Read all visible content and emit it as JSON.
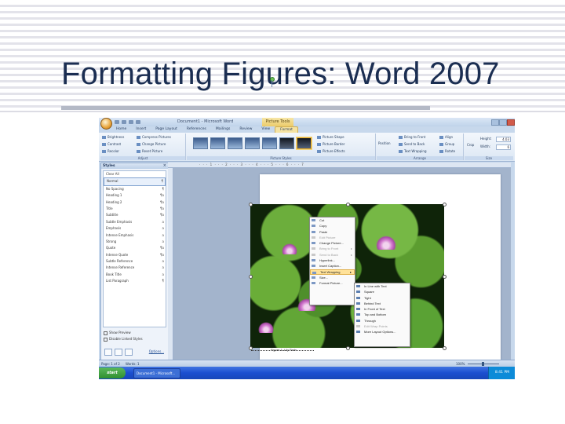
{
  "slide": {
    "title": "Formatting Figures: Word 2007"
  },
  "window": {
    "title": "Document1 - Microsoft Word",
    "context_tab": "Picture Tools"
  },
  "ribbon": {
    "tabs": [
      "Home",
      "Insert",
      "Page Layout",
      "References",
      "Mailings",
      "Review",
      "View",
      "Format"
    ],
    "active_tab": "Format",
    "groups": {
      "adjust": {
        "label": "Adjust",
        "items": [
          "Brightness",
          "Compress Pictures",
          "Contrast",
          "Change Picture",
          "Recolor",
          "Reset Picture"
        ]
      },
      "picture_styles": {
        "label": "Picture Styles",
        "items": [
          "Picture Shape",
          "Picture Border",
          "Picture Effects"
        ]
      },
      "arrange": {
        "label": "Arrange",
        "items": [
          "Position",
          "Bring to Front",
          "Send to Back",
          "Text Wrapping",
          "Align",
          "Group",
          "Rotate"
        ]
      },
      "size": {
        "label": "Size",
        "crop_label": "Crop",
        "height_label": "Height:",
        "height_value": "4.03",
        "width_label": "Width:",
        "width_value": "6"
      }
    }
  },
  "styles_pane": {
    "title": "Styles",
    "close": "×",
    "items": [
      {
        "name": "Clear All",
        "mark": ""
      },
      {
        "name": "Normal",
        "mark": "¶"
      },
      {
        "name": "No Spacing",
        "mark": "¶"
      },
      {
        "name": "Heading 1",
        "mark": "¶a"
      },
      {
        "name": "Heading 2",
        "mark": "¶a"
      },
      {
        "name": "Title",
        "mark": "¶a"
      },
      {
        "name": "Subtitle",
        "mark": "¶a"
      },
      {
        "name": "Subtle Emphasis",
        "mark": "a"
      },
      {
        "name": "Emphasis",
        "mark": "a"
      },
      {
        "name": "Intense Emphasis",
        "mark": "a"
      },
      {
        "name": "Strong",
        "mark": "a"
      },
      {
        "name": "Quote",
        "mark": "¶a"
      },
      {
        "name": "Intense Quote",
        "mark": "¶a"
      },
      {
        "name": "Subtle Reference",
        "mark": "a"
      },
      {
        "name": "Intense Reference",
        "mark": "a"
      },
      {
        "name": "Book Title",
        "mark": "a"
      },
      {
        "name": "List Paragraph",
        "mark": "¶"
      }
    ],
    "selected_index": 1,
    "show_preview": "Show Preview",
    "disable_linked": "Disable Linked Styles",
    "options": "Options..."
  },
  "document": {
    "caption": "Figure 1: Lily Pads"
  },
  "context_menu": {
    "items": [
      {
        "label": "Cut",
        "dim": false,
        "sub": false
      },
      {
        "label": "Copy",
        "dim": false,
        "sub": false
      },
      {
        "label": "Paste",
        "dim": false,
        "sub": false
      },
      {
        "label": "Edit Picture",
        "dim": true,
        "sub": false
      },
      {
        "label": "Change Picture...",
        "dim": false,
        "sub": false
      },
      {
        "label": "Bring to Front",
        "dim": true,
        "sub": true
      },
      {
        "label": "Send to Back",
        "dim": true,
        "sub": true
      },
      {
        "label": "Hyperlink...",
        "dim": false,
        "sub": false
      },
      {
        "label": "Insert Caption...",
        "dim": false,
        "sub": false
      },
      {
        "label": "Text Wrapping",
        "dim": false,
        "sub": true
      },
      {
        "label": "Size...",
        "dim": false,
        "sub": false
      },
      {
        "label": "Format Picture...",
        "dim": false,
        "sub": false
      }
    ],
    "highlighted_index": 9
  },
  "wrap_submenu": {
    "items": [
      {
        "label": "In Line with Text",
        "dim": false
      },
      {
        "label": "Square",
        "dim": false
      },
      {
        "label": "Tight",
        "dim": false
      },
      {
        "label": "Behind Text",
        "dim": false
      },
      {
        "label": "In Front of Text",
        "dim": false
      },
      {
        "label": "Top and Bottom",
        "dim": false
      },
      {
        "label": "Through",
        "dim": false
      },
      {
        "label": "Edit Wrap Points",
        "dim": true
      },
      {
        "label": "More Layout Options...",
        "dim": false
      }
    ]
  },
  "status_bar": {
    "page": "Page: 1 of 2",
    "words": "Words: 1",
    "zoom": "100%"
  },
  "taskbar": {
    "start": "start",
    "task": "Document1 - Microsoft...",
    "clock": "8:41 PM"
  },
  "colors": {
    "title": "#1b2e52",
    "ribbon_context": "#eccb6a",
    "menu_highlight": "#ffe29a",
    "taskbar": "#1b4fd0"
  }
}
